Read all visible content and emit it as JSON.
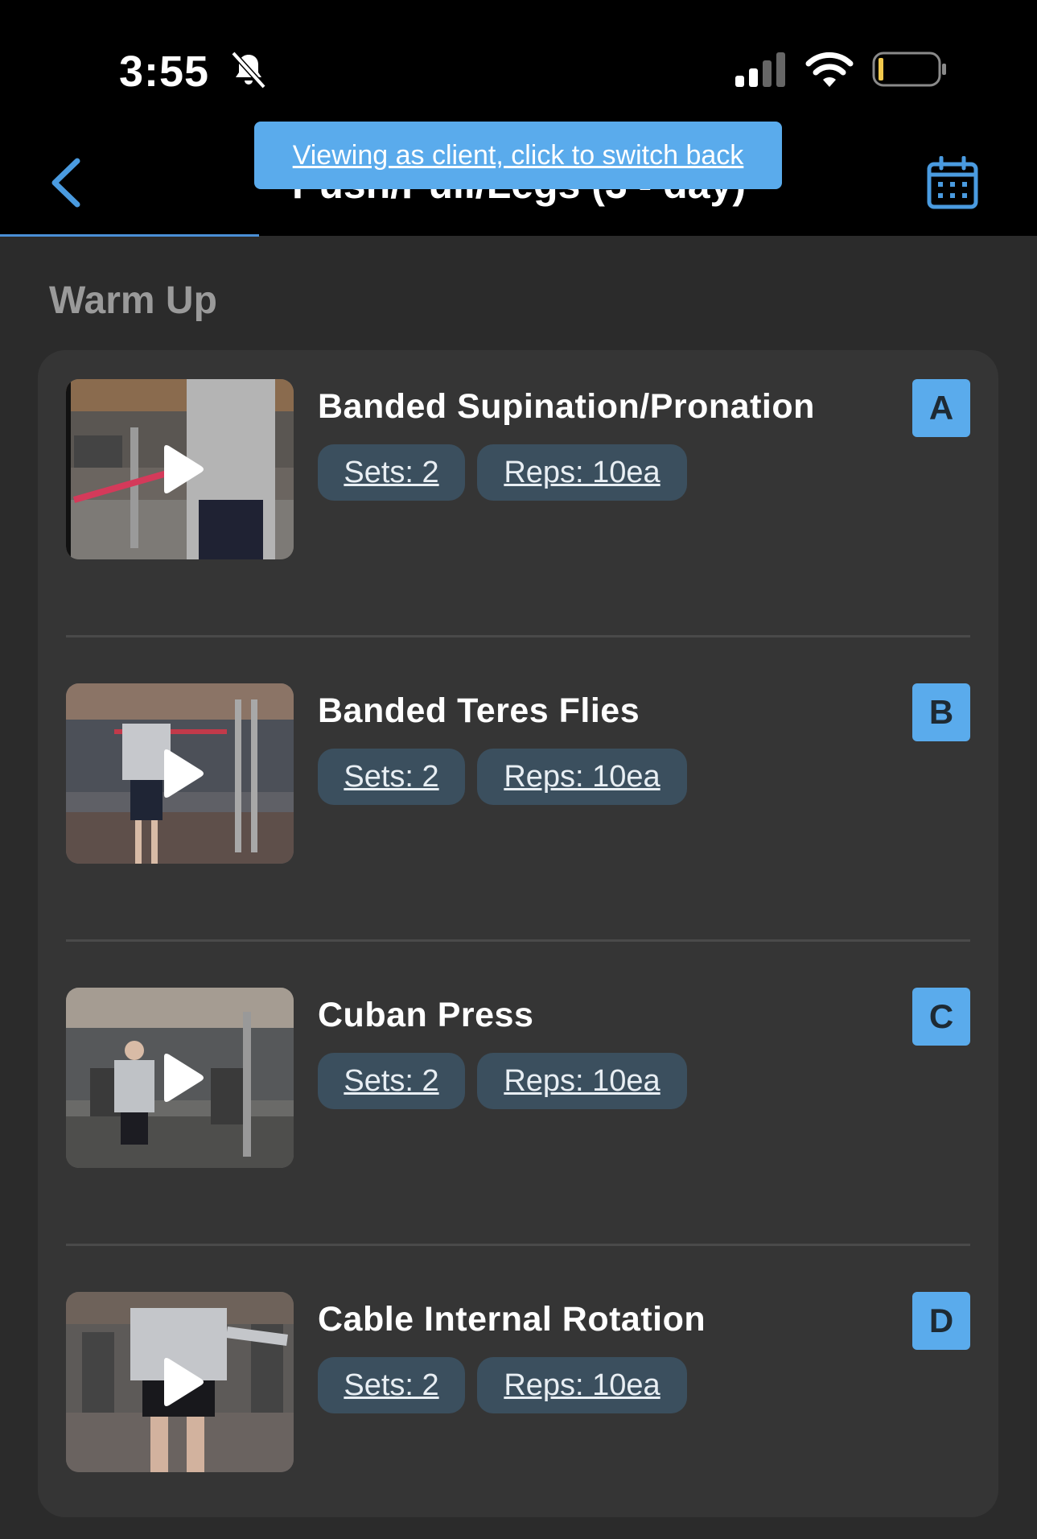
{
  "status_bar": {
    "time": "3:55"
  },
  "header": {
    "title": "Push/Pull/Legs (3 - day)",
    "client_banner": "Viewing as client, click to switch back"
  },
  "section": {
    "title": "Warm Up"
  },
  "exercises": [
    {
      "name": "Banded Supination/Pronation",
      "sets": "Sets: 2",
      "reps": "Reps: 10ea",
      "label": "A"
    },
    {
      "name": "Banded Teres Flies",
      "sets": "Sets: 2",
      "reps": "Reps: 10ea",
      "label": "B"
    },
    {
      "name": "Cuban Press",
      "sets": "Sets: 2",
      "reps": "Reps: 10ea",
      "label": "C"
    },
    {
      "name": "Cable Internal Rotation",
      "sets": "Sets: 2",
      "reps": "Reps: 10ea",
      "label": "D"
    }
  ],
  "colors": {
    "accent": "#5aabec",
    "background": "#2b2b2b",
    "card": "#353535",
    "pill": "#3b4f5e"
  },
  "icons": [
    "bell-slash-icon",
    "signal-icon",
    "wifi-icon",
    "battery-icon",
    "chevron-left-icon",
    "calendar-icon",
    "play-icon"
  ]
}
